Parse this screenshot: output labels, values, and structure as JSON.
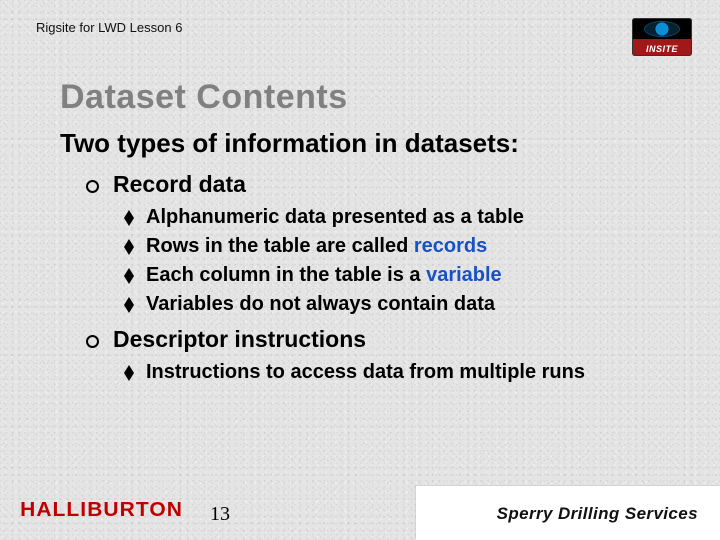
{
  "header": {
    "lesson": "Rigsite for LWD Lesson 6"
  },
  "badge": {
    "label": "INSITE"
  },
  "title": "Dataset Contents",
  "subtitle": "Two types of information in datasets:",
  "items": [
    {
      "label": "Record data",
      "sub": [
        {
          "pre": "Alphanumeric data presented as a table"
        },
        {
          "pre": "Rows in the table are called ",
          "hl": "records"
        },
        {
          "pre": "Each column in the table is a ",
          "hl": "variable"
        },
        {
          "pre": "Variables do not always contain data"
        }
      ]
    },
    {
      "label": "Descriptor instructions",
      "sub": [
        {
          "pre": "Instructions to access data from multiple runs"
        }
      ]
    }
  ],
  "footer": {
    "halliburton": "HALLIBURTON",
    "page": "13",
    "sperry": "Sperry Drilling Services"
  }
}
